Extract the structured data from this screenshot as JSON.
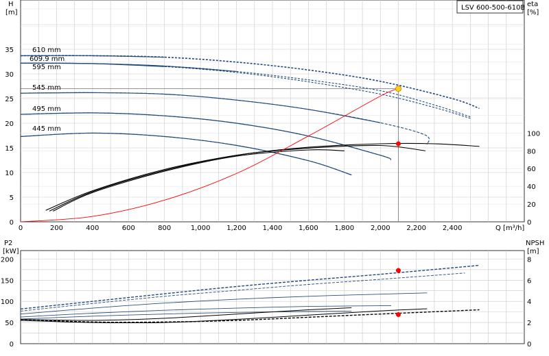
{
  "chart_data": [
    {
      "type": "line",
      "model": "LSV 600-500-610B",
      "x_axis": {
        "title": "Q [m³/h]",
        "range": [
          0,
          2800
        ],
        "ticks": [
          "0",
          "200",
          "400",
          "600",
          "800",
          "1,000",
          "1,200",
          "1,400",
          "1,600",
          "1,800",
          "2,000",
          "2,200",
          "2,400"
        ]
      },
      "y_axis_left": {
        "title_line1": "H",
        "title_line2": "[m]",
        "range": [
          0,
          45
        ],
        "ticks": [
          "0",
          "5",
          "10",
          "15",
          "20",
          "25",
          "30",
          "35"
        ]
      },
      "y_axis_right": {
        "title_line1": "eta",
        "title_line2": "[%]",
        "range": [
          0,
          250
        ],
        "ticks": [
          "0",
          "20",
          "40",
          "60",
          "80",
          "100"
        ]
      },
      "grid": true,
      "head_curves": [
        {
          "name": "610 mm",
          "points": [
            [
              0,
              33.7
            ],
            [
              400,
              33.7
            ],
            [
              800,
              33.4
            ],
            [
              1200,
              32.4
            ],
            [
              1600,
              30.8
            ],
            [
              2000,
              28.5
            ],
            [
              2400,
              25.0
            ],
            [
              2550,
              23.0
            ]
          ]
        },
        {
          "name": "609.9 mm",
          "points": [
            [
              0,
              32.2
            ],
            [
              400,
              32.1
            ],
            [
              800,
              31.6
            ],
            [
              1200,
              30.5
            ],
            [
              1600,
              28.8
            ],
            [
              2000,
              26.6
            ],
            [
              2300,
              23.7
            ],
            [
              2500,
              21.3
            ]
          ]
        },
        {
          "name": "595 mm",
          "points": [
            [
              0,
              32.2
            ],
            [
              400,
              32.1
            ],
            [
              800,
              31.5
            ],
            [
              1200,
              30.3
            ],
            [
              1600,
              28.4
            ],
            [
              2000,
              25.9
            ],
            [
              2300,
              23.2
            ],
            [
              2500,
              21.0
            ]
          ]
        },
        {
          "name": "545 mm",
          "points": [
            [
              0,
              26.1
            ],
            [
              400,
              26.2
            ],
            [
              800,
              25.9
            ],
            [
              1200,
              24.7
            ],
            [
              1600,
              22.8
            ],
            [
              2000,
              20.1
            ],
            [
              2250,
              17.6
            ],
            [
              2260,
              15.7
            ]
          ]
        },
        {
          "name": "495 mm",
          "points": [
            [
              0,
              21.8
            ],
            [
              400,
              22.1
            ],
            [
              800,
              21.5
            ],
            [
              1200,
              20.0
            ],
            [
              1600,
              17.4
            ],
            [
              2000,
              13.5
            ],
            [
              2060,
              12.6
            ]
          ]
        },
        {
          "name": "445 mm",
          "points": [
            [
              0,
              17.3
            ],
            [
              400,
              18.0
            ],
            [
              800,
              17.3
            ],
            [
              1200,
              15.5
            ],
            [
              1600,
              12.4
            ],
            [
              1840,
              9.5
            ]
          ]
        }
      ],
      "efficiency_curves": [
        {
          "points": [
            [
              140,
              13
            ],
            [
              400,
              35
            ],
            [
              800,
              59
            ],
            [
              1200,
              75
            ],
            [
              1600,
              84
            ],
            [
              2000,
              88
            ],
            [
              2300,
              88
            ],
            [
              2550,
              85
            ]
          ]
        },
        {
          "points": [
            [
              160,
              12
            ],
            [
              400,
              34
            ],
            [
              800,
              58
            ],
            [
              1200,
              75
            ],
            [
              1600,
              83
            ],
            [
              2000,
              86
            ],
            [
              2250,
              80
            ]
          ]
        },
        {
          "points": [
            [
              180,
              12
            ],
            [
              400,
              33
            ],
            [
              800,
              57
            ],
            [
              1200,
              74
            ],
            [
              1600,
              81
            ],
            [
              1800,
              80
            ]
          ]
        }
      ],
      "system_curve": {
        "color": "#ff0000",
        "points": [
          [
            0,
            0
          ],
          [
            400,
            1.1
          ],
          [
            800,
            4.4
          ],
          [
            1200,
            9.8
          ],
          [
            1600,
            17.4
          ],
          [
            2000,
            25.5
          ],
          [
            2100,
            27.0
          ]
        ]
      },
      "duty_point": {
        "Q": 2100,
        "H": 27.0,
        "eta": 88
      },
      "power": {
        "y_axis_left": {
          "title_line1": "P2",
          "title_line2": "[kW]",
          "range": [
            0,
            220
          ],
          "ticks": [
            "0",
            "50",
            "100",
            "150",
            "200"
          ]
        },
        "y_axis_right": {
          "title_line1": "NPSH",
          "title_line2": "[m]",
          "range": [
            0,
            8.8
          ],
          "ticks": [
            "0",
            "2",
            "4",
            "6",
            "8"
          ]
        },
        "p2_curves": [
          {
            "points": [
              [
                0,
                82
              ],
              [
                400,
                100
              ],
              [
                800,
                118
              ],
              [
                1200,
                135
              ],
              [
                1600,
                150
              ],
              [
                2000,
                164
              ],
              [
                2550,
                185
              ]
            ]
          },
          {
            "points": [
              [
                0,
                77
              ],
              [
                400,
                95
              ],
              [
                800,
                112
              ],
              [
                1200,
                126
              ],
              [
                1600,
                140
              ],
              [
                2000,
                152
              ],
              [
                2470,
                167
              ]
            ]
          },
          {
            "points": [
              [
                0,
                70
              ],
              [
                400,
                84
              ],
              [
                800,
                96
              ],
              [
                1200,
                105
              ],
              [
                1600,
                112
              ],
              [
                2000,
                117
              ],
              [
                2260,
                120
              ]
            ]
          },
          {
            "points": [
              [
                0,
                63
              ],
              [
                400,
                72
              ],
              [
                800,
                79
              ],
              [
                1200,
                84
              ],
              [
                1600,
                88
              ],
              [
                2060,
                90
              ]
            ]
          },
          {
            "points": [
              [
                0,
                58
              ],
              [
                400,
                65
              ],
              [
                800,
                70
              ],
              [
                1200,
                74
              ],
              [
                1600,
                76
              ],
              [
                1840,
                77
              ]
            ]
          }
        ],
        "npsh_curves": [
          {
            "points": [
              [
                0,
                2.3
              ],
              [
                400,
                2.05
              ],
              [
                800,
                2.05
              ],
              [
                1200,
                2.2
              ],
              [
                1600,
                2.5
              ],
              [
                2000,
                2.8
              ],
              [
                2550,
                3.2
              ]
            ]
          },
          {
            "points": [
              [
                0,
                2.2
              ],
              [
                400,
                2.0
              ],
              [
                800,
                2.0
              ],
              [
                1200,
                2.3
              ],
              [
                1600,
                2.7
              ],
              [
                2000,
                3.1
              ],
              [
                2260,
                3.3
              ]
            ]
          },
          {
            "points": [
              [
                0,
                2.3
              ],
              [
                400,
                2.2
              ],
              [
                800,
                2.4
              ],
              [
                1200,
                2.8
              ],
              [
                1600,
                3.2
              ],
              [
                1840,
                3.4
              ]
            ]
          }
        ],
        "duty_p2": 173,
        "duty_npsh": 2.75
      }
    }
  ]
}
